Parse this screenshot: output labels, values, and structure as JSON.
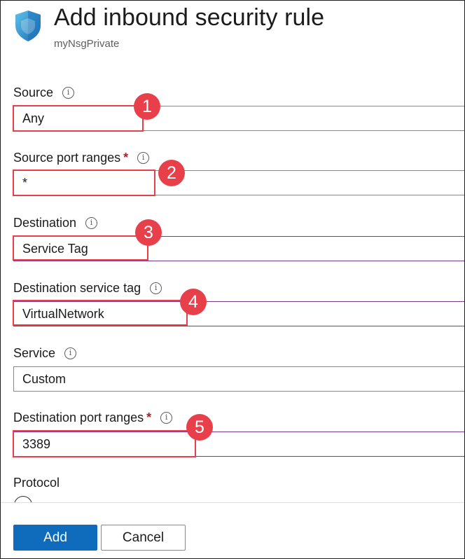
{
  "header": {
    "title": "Add inbound security rule",
    "subtitle": "myNsgPrivate"
  },
  "fields": [
    {
      "label": "Source",
      "required": false,
      "value": "Any",
      "badge": "1"
    },
    {
      "label": "Source port ranges",
      "required": true,
      "value": "*",
      "badge": "2"
    },
    {
      "label": "Destination",
      "required": false,
      "value": "Service Tag",
      "badge": "3"
    },
    {
      "label": "Destination service tag",
      "required": false,
      "value": "VirtualNetwork",
      "badge": "4"
    },
    {
      "label": "Service",
      "required": false,
      "value": "Custom"
    },
    {
      "label": "Destination port ranges",
      "required": true,
      "value": "3389",
      "badge": "5"
    }
  ],
  "protocol": {
    "label": "Protocol"
  },
  "required_marker": "*",
  "info_glyph": "i",
  "buttons": {
    "add": "Add",
    "cancel": "Cancel"
  },
  "colors": {
    "accent": "#0f6cbd",
    "annotation": "#e8404b",
    "required": "#a4262c"
  }
}
